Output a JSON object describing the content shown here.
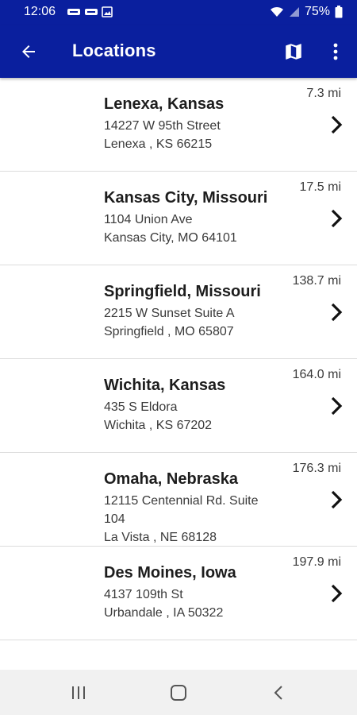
{
  "colors": {
    "app_bar": "#0a1f9e",
    "on_app_bar": "#ffffff",
    "divider": "#dcdcdc",
    "nav_bar": "#f1f1f1"
  },
  "status_bar": {
    "time": "12:06",
    "battery": "75%",
    "icons": [
      "notification-icon",
      "notification-icon",
      "image-icon",
      "wifi-icon",
      "signal-icon",
      "battery-icon"
    ]
  },
  "app_bar": {
    "title": "Locations",
    "icons": [
      "back-arrow-icon",
      "map-icon",
      "more-vert-icon"
    ]
  },
  "locations": [
    {
      "name": "Lenexa, Kansas",
      "lines": [
        "14227 W 95th Street",
        "Lenexa , KS 66215"
      ],
      "distance": "7.3 mi"
    },
    {
      "name": "Kansas City, Missouri",
      "lines": [
        "1104 Union Ave",
        "Kansas City, MO 64101"
      ],
      "distance": "17.5 mi"
    },
    {
      "name": "Springfield, Missouri",
      "lines": [
        "2215 W Sunset Suite A",
        "Springfield , MO 65807"
      ],
      "distance": "138.7 mi"
    },
    {
      "name": "Wichita, Kansas",
      "lines": [
        "435 S Eldora",
        "Wichita , KS 67202"
      ],
      "distance": "164.0 mi"
    },
    {
      "name": "Omaha, Nebraska",
      "lines": [
        "12115 Centennial Rd. Suite",
        "104",
        "La Vista , NE 68128"
      ],
      "distance": "176.3 mi"
    },
    {
      "name": "Des Moines, Iowa",
      "lines": [
        "4137 109th St",
        "Urbandale , IA 50322"
      ],
      "distance": "197.9 mi"
    }
  ],
  "nav_bar": {
    "icons": [
      "recent-apps-icon",
      "home-icon",
      "back-icon"
    ]
  }
}
